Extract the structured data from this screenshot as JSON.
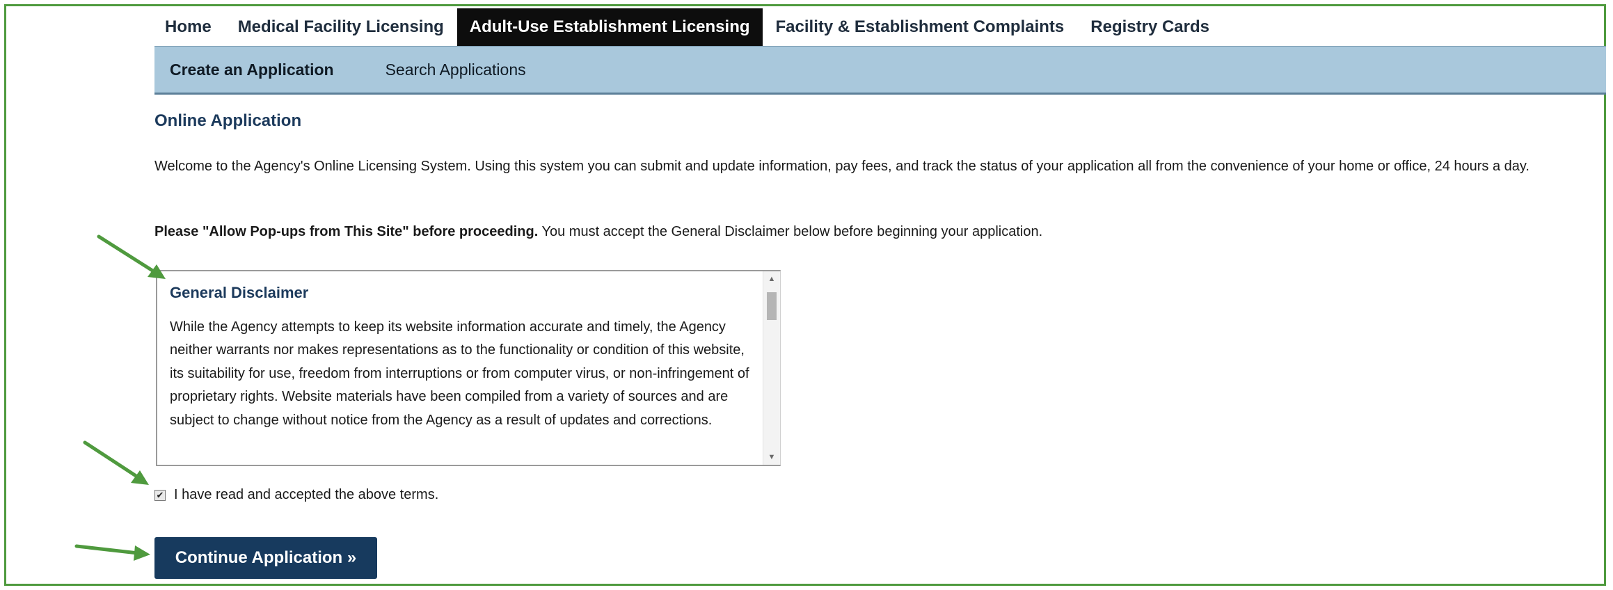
{
  "top_nav": {
    "items": [
      {
        "label": "Home"
      },
      {
        "label": "Medical Facility Licensing"
      },
      {
        "label": "Adult-Use Establishment Licensing"
      },
      {
        "label": "Facility & Establishment Complaints"
      },
      {
        "label": "Registry Cards"
      }
    ],
    "active_index": 2
  },
  "sub_nav": {
    "items": [
      {
        "label": "Create an Application"
      },
      {
        "label": "Search Applications"
      }
    ],
    "active_index": 0
  },
  "main": {
    "heading": "Online Application",
    "welcome_text": "Welcome to the Agency's Online Licensing System. Using this system you can submit and update information, pay fees, and track the status of your application all from the convenience of your home or office, 24 hours a day.",
    "popup_note_bold": "Please \"Allow Pop-ups from This Site\" before proceeding.",
    "popup_note_rest": " You must accept the General Disclaimer below before beginning your application."
  },
  "disclaimer": {
    "title": "General Disclaimer",
    "text": "While the Agency attempts to keep its website information accurate and timely, the Agency neither warrants nor makes representations as to the functionality or condition of this website, its suitability for use, freedom from interruptions or from computer virus, or non-infringement of proprietary rights. Website materials have been compiled from a variety of sources and are subject to change without notice from the Agency as a result of updates and corrections."
  },
  "terms": {
    "checked": true,
    "label": "I have read and accepted the above terms."
  },
  "continue_button": {
    "label": "Continue Application »"
  },
  "colors": {
    "nav_active_bg": "#0d0d0d",
    "subnav_bg": "#a9c8dc",
    "heading": "#1c3a5c",
    "button_bg": "#173a5e",
    "frame_border": "#4f9a3e",
    "annotation_arrow": "#4f9a3e"
  }
}
